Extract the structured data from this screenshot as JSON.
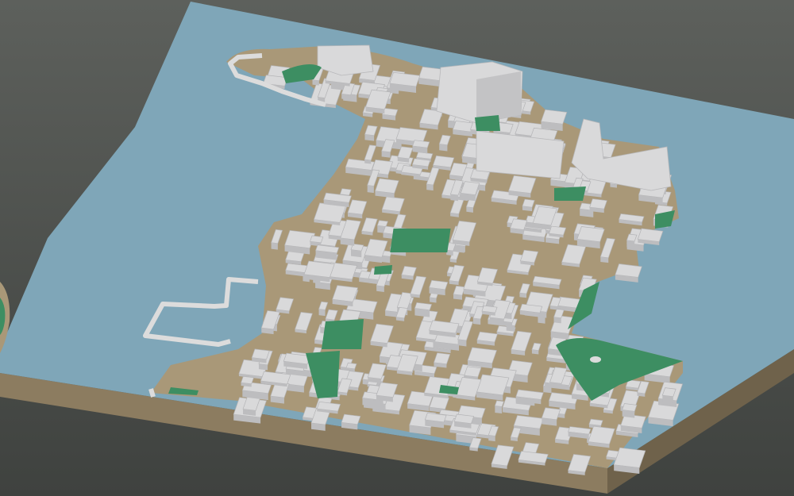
{
  "scene": {
    "type": "3d-city-model-render",
    "background_color_top": "#5d605c",
    "background_color_bottom": "#3f423f",
    "water_color": "#7fa6b8",
    "terrain_color": "#a99878",
    "base_side_color": "#8c7c60",
    "building_color": "#d9d9da",
    "park_color": "#3d8e62",
    "pier_color": "#dcdcdc"
  }
}
